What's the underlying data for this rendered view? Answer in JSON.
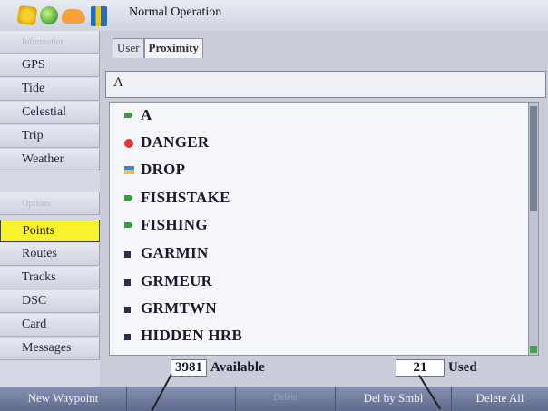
{
  "header": {
    "title": "Normal Operation"
  },
  "status_icons": [
    "sun-icon",
    "globe-icon",
    "cloud-icon",
    "satellite-icon"
  ],
  "sidebar": {
    "items": [
      {
        "label": "Information",
        "state": "disabled"
      },
      {
        "label": "GPS",
        "state": "normal"
      },
      {
        "label": "Tide",
        "state": "normal"
      },
      {
        "label": "Celestial",
        "state": "normal"
      },
      {
        "label": "Trip",
        "state": "normal"
      },
      {
        "label": "Weather",
        "state": "normal"
      },
      {
        "label": "Options",
        "state": "disabled"
      },
      {
        "label": "Points",
        "state": "selected"
      },
      {
        "label": "Routes",
        "state": "normal"
      },
      {
        "label": "Tracks",
        "state": "normal"
      },
      {
        "label": "DSC",
        "state": "normal"
      },
      {
        "label": "Card",
        "state": "normal"
      },
      {
        "label": "Messages",
        "state": "normal"
      }
    ]
  },
  "tabs": [
    {
      "label": "User",
      "selected": false
    },
    {
      "label": "Proximity",
      "selected": true
    }
  ],
  "search": {
    "value": "A"
  },
  "waypoints": [
    {
      "name": "A",
      "icon": "flag-icon"
    },
    {
      "name": "DANGER",
      "icon": "danger-icon"
    },
    {
      "name": "DROP",
      "icon": "picture-icon"
    },
    {
      "name": "FISHSTAKE",
      "icon": "flag-icon"
    },
    {
      "name": "FISHING",
      "icon": "flag-icon"
    },
    {
      "name": "GARMIN",
      "icon": "square-icon"
    },
    {
      "name": "GRMEUR",
      "icon": "square-icon"
    },
    {
      "name": "GRMTWN",
      "icon": "square-icon"
    },
    {
      "name": "HIDDEN HRB",
      "icon": "square-icon"
    }
  ],
  "counts": {
    "available_value": "3981",
    "available_label": "Available",
    "used_value": "21",
    "used_label": "Used"
  },
  "softkeys": [
    {
      "label": "New Waypoint",
      "enabled": true
    },
    {
      "label": "",
      "enabled": true
    },
    {
      "label": "Delete",
      "enabled": false
    },
    {
      "label": "Del by Smbl",
      "enabled": true
    },
    {
      "label": "Delete All",
      "enabled": true
    }
  ],
  "colors": {
    "selected_tab": "#f8f12d",
    "softkey_bar": "#6f7a9c",
    "flag": "#3b9c3b",
    "danger": "#e3373c"
  }
}
